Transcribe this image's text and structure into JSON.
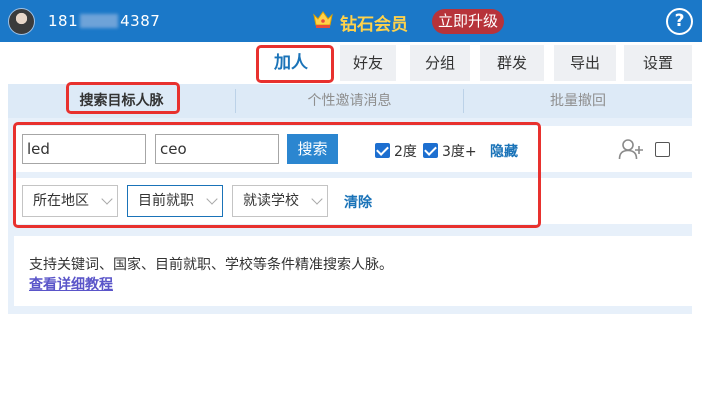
{
  "header": {
    "phone_prefix": "181",
    "phone_suffix": "4387",
    "vip_label": "钻石会员",
    "upgrade_label": "立即升级",
    "help_label": "?",
    "bg_color": "#1b78c8",
    "upgrade_color": "#b7333a",
    "vip_color": "#ffd24a"
  },
  "nav": {
    "items": [
      {
        "label": "加人",
        "active": true
      },
      {
        "label": "好友"
      },
      {
        "label": "分组"
      },
      {
        "label": "群发"
      },
      {
        "label": "导出"
      },
      {
        "label": "设置"
      }
    ]
  },
  "subtabs": [
    {
      "label": "搜索目标人脉",
      "active": true
    },
    {
      "label": "个性邀请消息"
    },
    {
      "label": "批量撤回"
    }
  ],
  "search": {
    "keyword_value": "led",
    "title_value": "ceo",
    "search_label": "搜索",
    "degree2_label": "2度",
    "degree2_checked": true,
    "degree3_label": "3度+",
    "degree3_checked": true,
    "hide_label": "隐藏",
    "add_person_icon": "add-person-icon",
    "select_all_checked": false
  },
  "filters": {
    "region_label": "所在地区",
    "current_job_label": "目前就职",
    "school_label": "就读学校",
    "clear_label": "清除"
  },
  "info": {
    "tip_text": "支持关键词、国家、目前就职、学校等条件精准搜索人脉。",
    "tutorial_link": "查看详细教程"
  },
  "colors": {
    "accent": "#1a73b8",
    "highlight_red": "#e8312e",
    "panel_bg": "#e7f0fa"
  }
}
